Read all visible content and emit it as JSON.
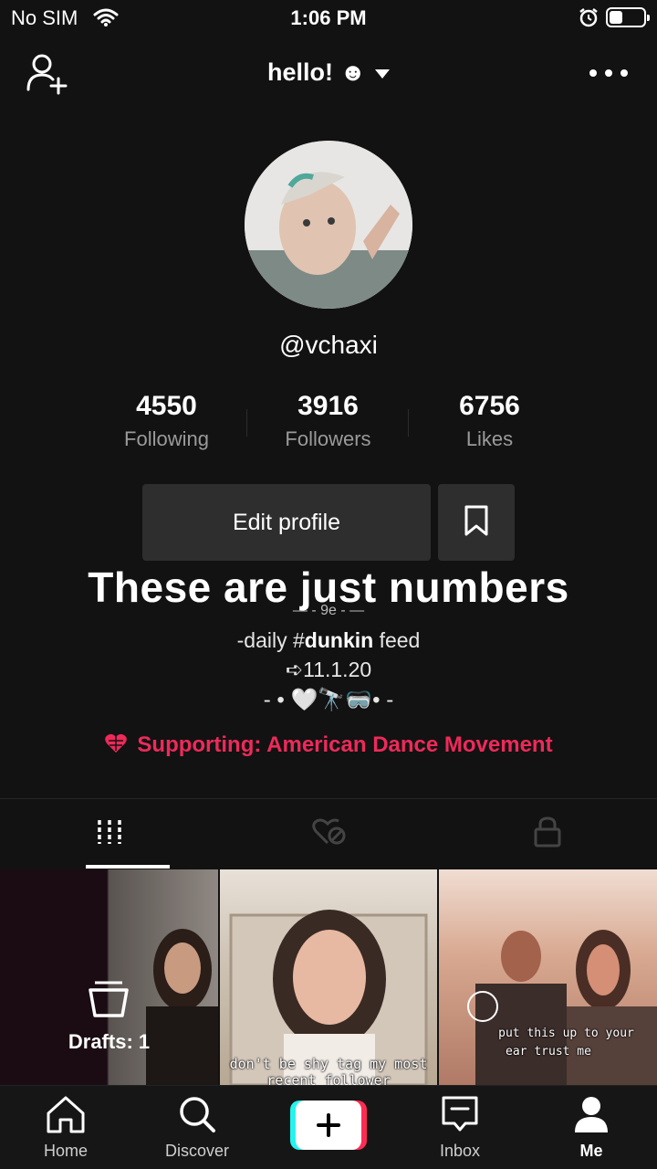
{
  "status_bar": {
    "carrier": "No SIM",
    "time": "1:06 PM",
    "battery_level": 0.4
  },
  "header": {
    "title": "hello! ☻"
  },
  "profile": {
    "username": "@vchaxi",
    "stats": [
      {
        "value": "4550",
        "label": "Following"
      },
      {
        "value": "3916",
        "label": "Followers"
      },
      {
        "value": "6756",
        "label": "Likes"
      }
    ],
    "edit_button": "Edit profile",
    "overlay_caption": "These are just numbers",
    "deco_line": "— - 9e - —",
    "bio_line1_prefix": "-daily #",
    "bio_line1_tag": "dunkin",
    "bio_line1_suffix": " feed",
    "bio_line2": "➪11.1.20",
    "bio_line3": "- • 🤍🔭🥽• -",
    "supporting": "Supporting: American Dance Movement"
  },
  "tabs": [
    {
      "icon": "grid-icon",
      "active": true
    },
    {
      "icon": "liked-hidden-icon",
      "active": false
    },
    {
      "icon": "lock-icon",
      "active": false
    }
  ],
  "videos": {
    "drafts_label": "Drafts: 1",
    "cell2_caption": "don't be shy tag my most recent follower",
    "cell3_caption_1": "put this up to your",
    "cell3_caption_2": "ear trust me"
  },
  "nav": [
    {
      "label": "Home",
      "icon": "home-icon"
    },
    {
      "label": "Discover",
      "icon": "search-icon"
    },
    {
      "label": "",
      "icon": "create-icon"
    },
    {
      "label": "Inbox",
      "icon": "inbox-icon"
    },
    {
      "label": "Me",
      "icon": "profile-icon"
    }
  ],
  "colors": {
    "background": "#121212",
    "accent": "#ee2a5a",
    "button": "#2e2e2e",
    "muted": "#9a9a9a"
  }
}
